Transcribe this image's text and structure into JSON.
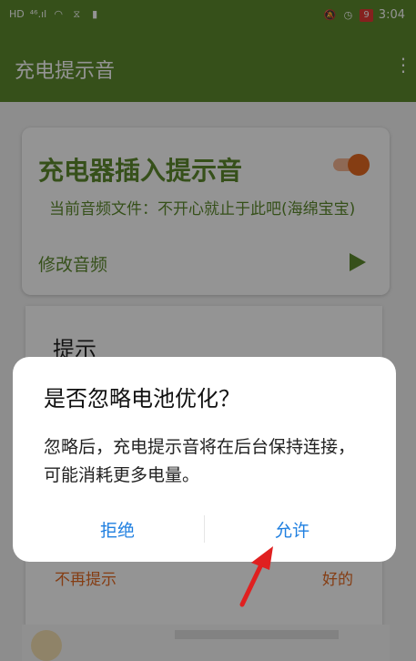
{
  "status_bar": {
    "left_icons": [
      "HD",
      "⁴⁶.ıl",
      "◠",
      "⧖",
      "▮"
    ],
    "right_icons": [
      "🔕",
      "◷"
    ],
    "battery": "9",
    "time": "3:04"
  },
  "app_bar": {
    "title": "充电提示音",
    "menu_icon": "⋮"
  },
  "card": {
    "title": "充电器插入提示音",
    "current_file": "当前音频文件：不开心就止于此吧(海绵宝宝)",
    "modify_label": "修改音频"
  },
  "hint_dialog": {
    "title": "提示",
    "dont_remind": "不再提示",
    "ok": "好的"
  },
  "battery_dialog": {
    "title": "是否忽略电池优化？",
    "message": "忽略后，充电提示音将在后台保持连接，可能消耗更多电量。",
    "deny": "拒绝",
    "allow": "允许"
  },
  "colors": {
    "brand_green": "#5d8b2e",
    "accent_orange": "#e56a22",
    "dialog_button_blue": "#1f7fe0",
    "annotation_arrow": "#e02020"
  }
}
